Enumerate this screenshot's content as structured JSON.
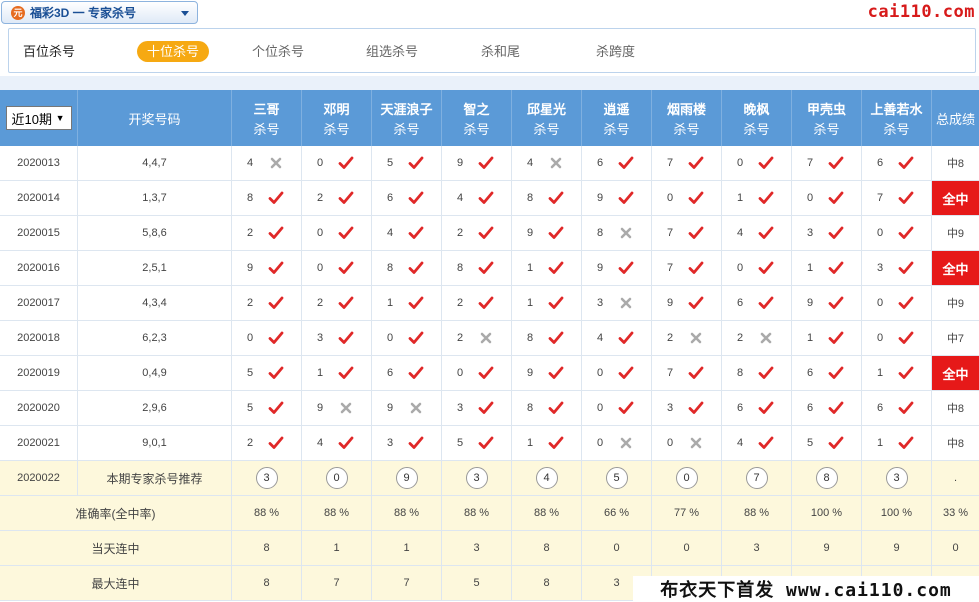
{
  "header": {
    "lottery_label": "福彩3D 一 专家杀号",
    "logo_mark": "元",
    "site_logo": "cai110.com"
  },
  "tabs": {
    "title": "百位杀号",
    "items": [
      "十位杀号",
      "个位杀号",
      "组选杀号",
      "杀和尾",
      "杀跨度"
    ],
    "active_index": 0
  },
  "table": {
    "period_select": "近10期",
    "draw_col_label": "开奖号码",
    "total_col_label": "总成绩",
    "expert_sub": "杀号",
    "experts": [
      "三哥",
      "邓明",
      "天涯浪子",
      "智之",
      "邱星光",
      "逍遥",
      "烟雨楼",
      "晚枫",
      "甲壳虫",
      "上善若水"
    ],
    "rows": [
      {
        "issue": "2020013",
        "draw": "4,4,7",
        "picks": [
          [
            "4",
            "x"
          ],
          [
            "0",
            "v"
          ],
          [
            "5",
            "v"
          ],
          [
            "9",
            "v"
          ],
          [
            "4",
            "x"
          ],
          [
            "6",
            "v"
          ],
          [
            "7",
            "v"
          ],
          [
            "0",
            "v"
          ],
          [
            "7",
            "v"
          ],
          [
            "6",
            "v"
          ]
        ],
        "total": "中8",
        "full": false
      },
      {
        "issue": "2020014",
        "draw": "1,3,7",
        "picks": [
          [
            "8",
            "v"
          ],
          [
            "2",
            "v"
          ],
          [
            "6",
            "v"
          ],
          [
            "4",
            "v"
          ],
          [
            "8",
            "v"
          ],
          [
            "9",
            "v"
          ],
          [
            "0",
            "v"
          ],
          [
            "1",
            "v"
          ],
          [
            "0",
            "v"
          ],
          [
            "7",
            "v"
          ]
        ],
        "total": "全中",
        "full": true
      },
      {
        "issue": "2020015",
        "draw": "5,8,6",
        "picks": [
          [
            "2",
            "v"
          ],
          [
            "0",
            "v"
          ],
          [
            "4",
            "v"
          ],
          [
            "2",
            "v"
          ],
          [
            "9",
            "v"
          ],
          [
            "8",
            "x"
          ],
          [
            "7",
            "v"
          ],
          [
            "4",
            "v"
          ],
          [
            "3",
            "v"
          ],
          [
            "0",
            "v"
          ]
        ],
        "total": "中9",
        "full": false
      },
      {
        "issue": "2020016",
        "draw": "2,5,1",
        "picks": [
          [
            "9",
            "v"
          ],
          [
            "0",
            "v"
          ],
          [
            "8",
            "v"
          ],
          [
            "8",
            "v"
          ],
          [
            "1",
            "v"
          ],
          [
            "9",
            "v"
          ],
          [
            "7",
            "v"
          ],
          [
            "0",
            "v"
          ],
          [
            "1",
            "v"
          ],
          [
            "3",
            "v"
          ]
        ],
        "total": "全中",
        "full": true
      },
      {
        "issue": "2020017",
        "draw": "4,3,4",
        "picks": [
          [
            "2",
            "v"
          ],
          [
            "2",
            "v"
          ],
          [
            "1",
            "v"
          ],
          [
            "2",
            "v"
          ],
          [
            "1",
            "v"
          ],
          [
            "3",
            "x"
          ],
          [
            "9",
            "v"
          ],
          [
            "6",
            "v"
          ],
          [
            "9",
            "v"
          ],
          [
            "0",
            "v"
          ]
        ],
        "total": "中9",
        "full": false
      },
      {
        "issue": "2020018",
        "draw": "6,2,3",
        "picks": [
          [
            "0",
            "v"
          ],
          [
            "3",
            "v"
          ],
          [
            "0",
            "v"
          ],
          [
            "2",
            "x"
          ],
          [
            "8",
            "v"
          ],
          [
            "4",
            "v"
          ],
          [
            "2",
            "x"
          ],
          [
            "2",
            "x"
          ],
          [
            "1",
            "v"
          ],
          [
            "0",
            "v"
          ]
        ],
        "total": "中7",
        "full": false
      },
      {
        "issue": "2020019",
        "draw": "0,4,9",
        "picks": [
          [
            "5",
            "v"
          ],
          [
            "1",
            "v"
          ],
          [
            "6",
            "v"
          ],
          [
            "0",
            "v"
          ],
          [
            "9",
            "v"
          ],
          [
            "0",
            "v"
          ],
          [
            "7",
            "v"
          ],
          [
            "8",
            "v"
          ],
          [
            "6",
            "v"
          ],
          [
            "1",
            "v"
          ]
        ],
        "total": "全中",
        "full": true
      },
      {
        "issue": "2020020",
        "draw": "2,9,6",
        "picks": [
          [
            "5",
            "v"
          ],
          [
            "9",
            "x"
          ],
          [
            "9",
            "x"
          ],
          [
            "3",
            "v"
          ],
          [
            "8",
            "v"
          ],
          [
            "0",
            "v"
          ],
          [
            "3",
            "v"
          ],
          [
            "6",
            "v"
          ],
          [
            "6",
            "v"
          ],
          [
            "6",
            "v"
          ]
        ],
        "total": "中8",
        "full": false
      },
      {
        "issue": "2020021",
        "draw": "9,0,1",
        "picks": [
          [
            "2",
            "v"
          ],
          [
            "4",
            "v"
          ],
          [
            "3",
            "v"
          ],
          [
            "5",
            "v"
          ],
          [
            "1",
            "v"
          ],
          [
            "0",
            "x"
          ],
          [
            "0",
            "x"
          ],
          [
            "4",
            "v"
          ],
          [
            "5",
            "v"
          ],
          [
            "1",
            "v"
          ]
        ],
        "total": "中8",
        "full": false
      }
    ],
    "recommend": {
      "issue": "2020022",
      "label": "本期专家杀号推荐",
      "values": [
        "3",
        "0",
        "9",
        "3",
        "4",
        "5",
        "0",
        "7",
        "8",
        "3"
      ],
      "total": "."
    },
    "accuracy": {
      "label": "准确率(全中率)",
      "values": [
        "88 %",
        "88 %",
        "88 %",
        "88 %",
        "88 %",
        "66 %",
        "77 %",
        "88 %",
        "100 %",
        "100 %"
      ],
      "total": "33 %"
    },
    "today_streak": {
      "label": "当天连中",
      "values": [
        "8",
        "1",
        "1",
        "3",
        "8",
        "0",
        "0",
        "3",
        "9",
        "9"
      ],
      "total": "0"
    },
    "max_streak": {
      "label": "最大连中",
      "values": [
        "8",
        "7",
        "7",
        "5",
        "8",
        "3",
        "",
        "",
        "",
        ""
      ],
      "total": ""
    }
  },
  "watermark": "布衣天下首发 www.cai110.com",
  "colors": {
    "header_blue": "#5b9ad7",
    "check_red": "#e02828",
    "cross_gray": "#aaaaaa",
    "tab_active": "#f6a912",
    "full_red": "#e61919",
    "summary_yellow": "#fdf8dc"
  }
}
